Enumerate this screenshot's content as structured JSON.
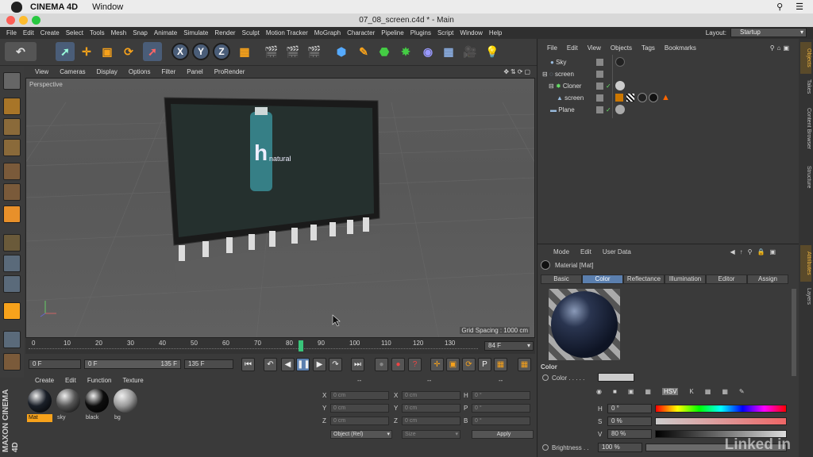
{
  "mac_menubar": {
    "app": "CINEMA 4D",
    "items": [
      "Window"
    ],
    "icons": [
      "search-icon",
      "list-icon"
    ]
  },
  "window": {
    "title": "07_08_screen.c4d * - Main"
  },
  "main_menu": [
    "File",
    "Edit",
    "Create",
    "Select",
    "Tools",
    "Mesh",
    "Snap",
    "Animate",
    "Simulate",
    "Render",
    "Sculpt",
    "Motion Tracker",
    "MoGraph",
    "Character",
    "Pipeline",
    "Plugins",
    "Script",
    "Window",
    "Help"
  ],
  "layout": {
    "label": "Layout:",
    "value": "Startup"
  },
  "toolbar": {
    "x_label": "X",
    "y_label": "Y",
    "z_label": "Z"
  },
  "viewport": {
    "menu": [
      "View",
      "Cameras",
      "Display",
      "Options",
      "Filter",
      "Panel",
      "ProRender"
    ],
    "label": "Perspective",
    "grid_spacing": "Grid Spacing : 1000 cm",
    "billboard_text": "natural",
    "billboard_letter": "h"
  },
  "timeline": {
    "ticks": [
      "0",
      "10",
      "20",
      "30",
      "40",
      "50",
      "60",
      "70",
      "80",
      "90",
      "100",
      "110",
      "120",
      "130"
    ],
    "current_frame": "84 F",
    "playhead_frame": 84,
    "start": "0 F",
    "range_start": "0 F",
    "range_end": "135 F",
    "end": "135 F"
  },
  "materials": {
    "menu": [
      "Create",
      "Edit",
      "Function",
      "Texture"
    ],
    "items": [
      {
        "name": "Mat",
        "color": "#1a1f28"
      },
      {
        "name": "sky",
        "color": "#555555"
      },
      {
        "name": "black",
        "color": "#0d0d0d"
      },
      {
        "name": "bg",
        "color": "#9a9a9a"
      }
    ]
  },
  "coordinates": {
    "dash1": "--",
    "dash2": "--",
    "dash3": "--",
    "rows": [
      {
        "a": "X",
        "av": "0 cm",
        "b": "X",
        "bv": "0 cm",
        "c": "H",
        "cv": "0 °"
      },
      {
        "a": "Y",
        "av": "0 cm",
        "b": "Y",
        "bv": "0 cm",
        "c": "P",
        "cv": "0 °"
      },
      {
        "a": "Z",
        "av": "0 cm",
        "b": "Z",
        "bv": "0 cm",
        "c": "B",
        "cv": "0 °"
      }
    ],
    "mode": "Object (Rel)",
    "size": "Size",
    "apply": "Apply"
  },
  "object_manager": {
    "menu": [
      "File",
      "Edit",
      "View",
      "Objects",
      "Tags",
      "Bookmarks"
    ],
    "objects": [
      {
        "name": "Sky",
        "indent": 0
      },
      {
        "name": "screen",
        "indent": 0
      },
      {
        "name": "Cloner",
        "indent": 1
      },
      {
        "name": "screen",
        "indent": 2
      },
      {
        "name": "Plane",
        "indent": 0
      }
    ]
  },
  "attributes": {
    "menu": [
      "Mode",
      "Edit",
      "User Data"
    ],
    "title": "Material [Mat]",
    "tabs": [
      "Basic",
      "Color",
      "Reflectance",
      "Illumination",
      "Editor",
      "Assign"
    ],
    "active_tab": "Color",
    "section": "Color",
    "color_label": "Color . . . . .",
    "h": {
      "label": "H",
      "value": "0 °"
    },
    "s": {
      "label": "S",
      "value": "0 %"
    },
    "v": {
      "label": "V",
      "value": "80 %"
    },
    "brightness": {
      "label": "Brightness . .",
      "value": "100 %"
    },
    "hsv": "HSV"
  },
  "side_tabs": [
    "Objects",
    "Takes",
    "Content Browser",
    "Structure",
    "Attributes",
    "Layers"
  ],
  "brand": {
    "maxon": "MAXON CINEMA 4D",
    "watermark": "Linked in"
  }
}
